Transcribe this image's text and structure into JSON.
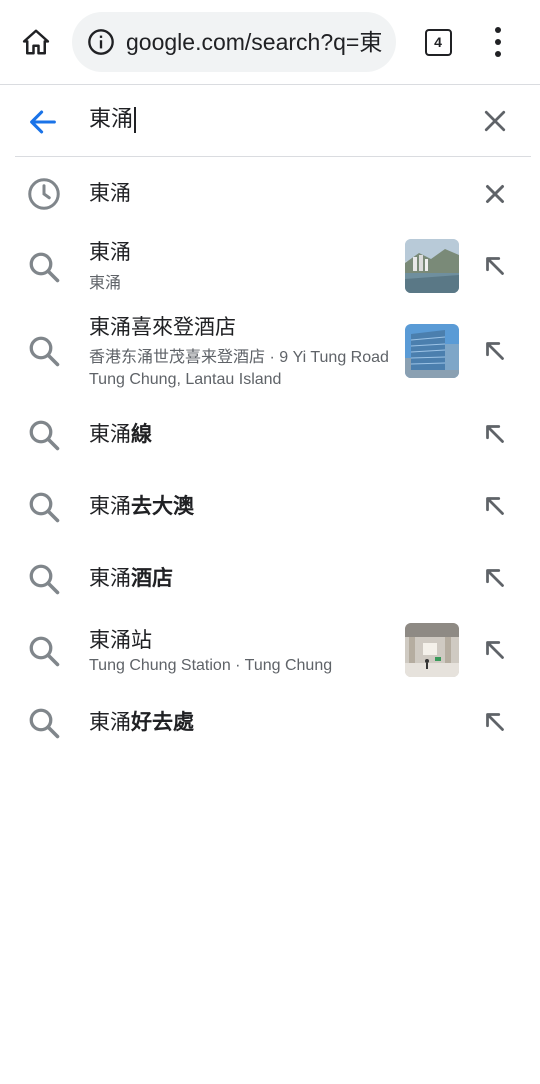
{
  "toolbar": {
    "url": "google.com/search?q=東",
    "tab_count": "4"
  },
  "search": {
    "query": "東涌"
  },
  "suggestions": [
    {
      "type": "history",
      "title": "東涌",
      "title_bold": "",
      "subtitle": "",
      "icon": "clock-icon",
      "action": "remove-icon"
    },
    {
      "type": "entity",
      "title": "東涌",
      "title_bold": "",
      "subtitle": "東涌",
      "icon": "search-icon",
      "action": "arrow-up-left-icon",
      "thumb": "coastal-town-photo"
    },
    {
      "type": "entity",
      "title": "東涌喜來登酒店",
      "title_bold": "",
      "subtitle": "香港东涌世茂喜来登酒店 · 9 Yi Tung Road Tung Chung, Lantau Island",
      "icon": "search-icon",
      "action": "arrow-up-left-icon",
      "thumb": "hotel-building-photo"
    },
    {
      "type": "query",
      "title": "東涌",
      "title_bold": "線",
      "subtitle": "",
      "icon": "search-icon",
      "action": "arrow-up-left-icon"
    },
    {
      "type": "query",
      "title": "東涌",
      "title_bold": "去大澳",
      "subtitle": "",
      "icon": "search-icon",
      "action": "arrow-up-left-icon"
    },
    {
      "type": "query",
      "title": "東涌",
      "title_bold": "酒店",
      "subtitle": "",
      "icon": "search-icon",
      "action": "arrow-up-left-icon"
    },
    {
      "type": "entity",
      "title": "東涌站",
      "title_bold": "",
      "subtitle": "Tung Chung Station · Tung Chung",
      "icon": "search-icon",
      "action": "arrow-up-left-icon",
      "thumb": "station-interior-photo"
    },
    {
      "type": "query",
      "title": "東涌",
      "title_bold": "好去處",
      "subtitle": "",
      "icon": "search-icon",
      "action": "arrow-up-left-icon"
    }
  ],
  "colors": {
    "accent": "#1a73e8",
    "icon_gray": "#80868b",
    "omnibox_bg": "#f1f3f4",
    "divider": "#dadce0"
  }
}
